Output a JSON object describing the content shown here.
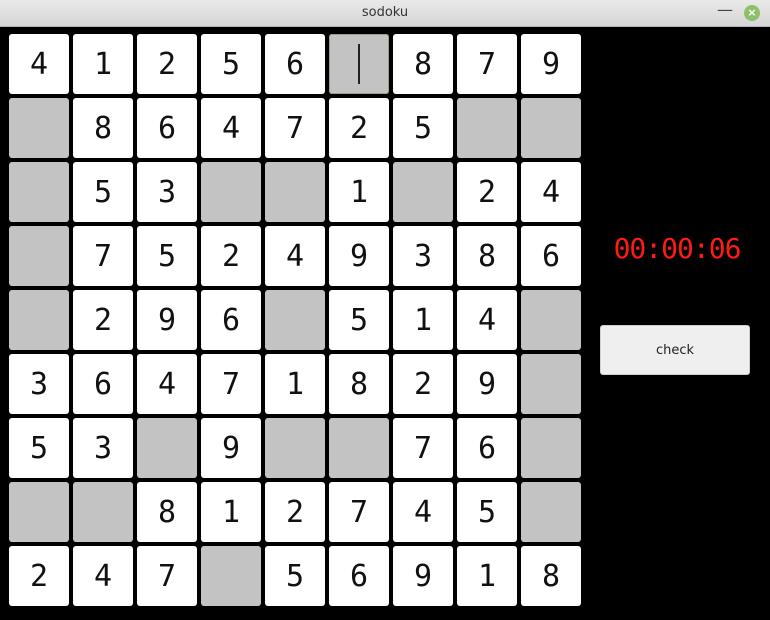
{
  "window": {
    "title": "sodoku"
  },
  "timer": {
    "text": "00:00:06"
  },
  "controls": {
    "check_label": "check"
  },
  "board": {
    "rows": [
      [
        "4",
        "1",
        "2",
        "5",
        "6",
        "",
        "8",
        "7",
        "9"
      ],
      [
        "",
        "8",
        "6",
        "4",
        "7",
        "2",
        "5",
        "",
        ""
      ],
      [
        "",
        "5",
        "3",
        "",
        "",
        "1",
        "",
        "2",
        "4"
      ],
      [
        "",
        "7",
        "5",
        "2",
        "4",
        "9",
        "3",
        "8",
        "6"
      ],
      [
        "",
        "2",
        "9",
        "6",
        "",
        "5",
        "1",
        "4",
        ""
      ],
      [
        "3",
        "6",
        "4",
        "7",
        "1",
        "8",
        "2",
        "9",
        ""
      ],
      [
        "5",
        "3",
        "",
        "9",
        "",
        "",
        "7",
        "6",
        ""
      ],
      [
        "",
        "",
        "8",
        "1",
        "2",
        "7",
        "4",
        "5",
        ""
      ],
      [
        "2",
        "4",
        "7",
        "",
        "5",
        "6",
        "9",
        "1",
        "8"
      ]
    ],
    "selected": {
      "row": 1,
      "col": 6
    }
  },
  "colors": {
    "filled_cell": "#ffffff",
    "empty_cell": "#c3c3c3",
    "timer": "#ff1a1a",
    "background": "#000000"
  },
  "icons": {
    "minimize": "minimize-icon",
    "close": "close-icon"
  }
}
